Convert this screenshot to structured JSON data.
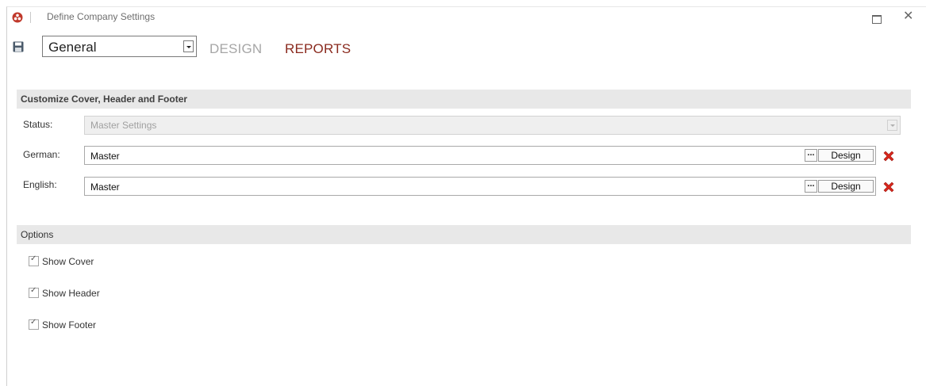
{
  "window": {
    "title": "Define Company Settings",
    "icons": {
      "app": "app-logo-icon",
      "maximize": "maximize-icon",
      "close": "close-icon"
    },
    "close_glyph": "✕"
  },
  "toolbar": {
    "save_icon": "save-icon",
    "layout_select": {
      "value": "General"
    },
    "tabs": [
      {
        "label": "DESIGN",
        "color": "#a6a6a6"
      },
      {
        "label": "REPORTS",
        "color": "#8a2a1e"
      }
    ]
  },
  "cover_section": {
    "title": "Customize Cover, Header and Footer",
    "status": {
      "label": "Status:",
      "value": "Master Settings"
    },
    "fields": [
      {
        "label": "German:",
        "value": "Master",
        "ellipsis_label": "...",
        "design_label": "Design"
      },
      {
        "label": "English:",
        "value": "Master",
        "ellipsis_label": "...",
        "design_label": "Design"
      }
    ]
  },
  "options_section": {
    "title": "Options",
    "checkboxes": [
      {
        "label": "Show Cover",
        "checked": true
      },
      {
        "label": "Show Header",
        "checked": true
      },
      {
        "label": "Show Footer",
        "checked": true
      }
    ]
  },
  "colors": {
    "accent": "#8a2a1e",
    "section_bg": "#e8e8e8",
    "delete_red": "#d9261c"
  }
}
